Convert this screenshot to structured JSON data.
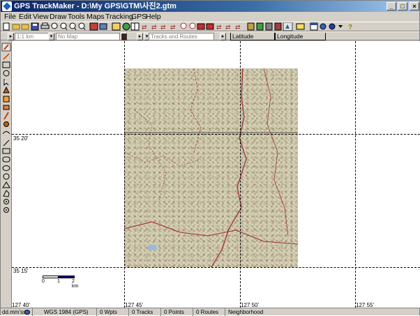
{
  "window": {
    "title": "GPS TrackMaker - D:\\My GPS\\GTM\\사진2.gtm",
    "controls": {
      "minimize": "_",
      "maximize": "□",
      "close": "×"
    }
  },
  "menu": [
    "File",
    "Edit",
    "View",
    "Draw",
    "Tools",
    "Maps",
    "Tracking",
    "GPS",
    "Help"
  ],
  "toolbar2": {
    "scale_value": "1:1 km",
    "map_value": "No Map",
    "tracks_value": "Tracks and Routes",
    "latitude_label": "Latitude",
    "longitude_label": "Longitude"
  },
  "map": {
    "lat_labels": [
      "35 20'",
      "35 15'"
    ],
    "lon_labels": [
      "127 40'",
      "127 45'",
      "127 50'",
      "127 55'"
    ],
    "scalebar": {
      "ticks": [
        "0",
        "1",
        "2 km"
      ]
    }
  },
  "status": {
    "coords_format": "dd.mm'ss\"",
    "datum": "WGS 1984 (GPS)",
    "waypoints": "0 Wpts",
    "tracks": "0 Tracks",
    "points": "0 Points",
    "routes": "0 Routes",
    "neighborhood": "Neighborhood"
  },
  "colors": {
    "titlebar_start": "#0a246a",
    "titlebar_end": "#a6caf0",
    "chrome": "#d4d0c8",
    "map_tile": "#d8d2b8",
    "road_red": "#a03030"
  }
}
